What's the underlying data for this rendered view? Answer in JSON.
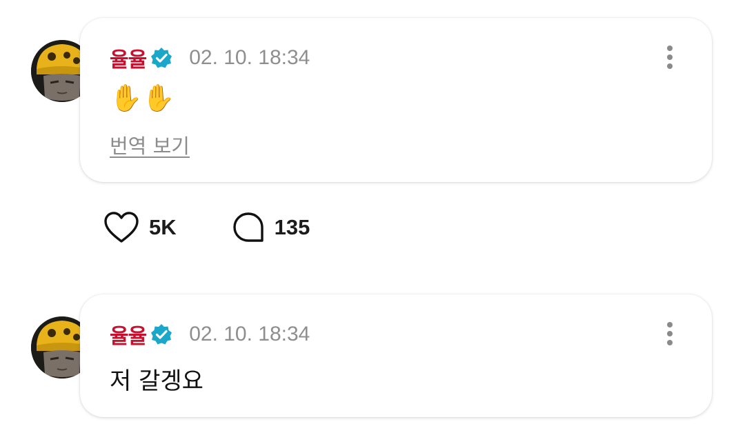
{
  "posts": [
    {
      "author": "율율",
      "verified": true,
      "timestamp": "02. 10. 18:34",
      "content": "✋✋",
      "translate_label": "번역 보기",
      "likes": "5K",
      "comments": "135"
    },
    {
      "author": "율율",
      "verified": true,
      "timestamp": "02. 10. 18:34",
      "content": "저 갈겡요"
    }
  ],
  "icons": {
    "verified": "verified-badge-icon",
    "more": "more-vertical-icon",
    "like": "heart-icon",
    "comment": "comment-bubble-icon"
  },
  "colors": {
    "author": "#c8102e",
    "verified_badge": "#1aa7c9",
    "timestamp": "#8e8e8e"
  }
}
